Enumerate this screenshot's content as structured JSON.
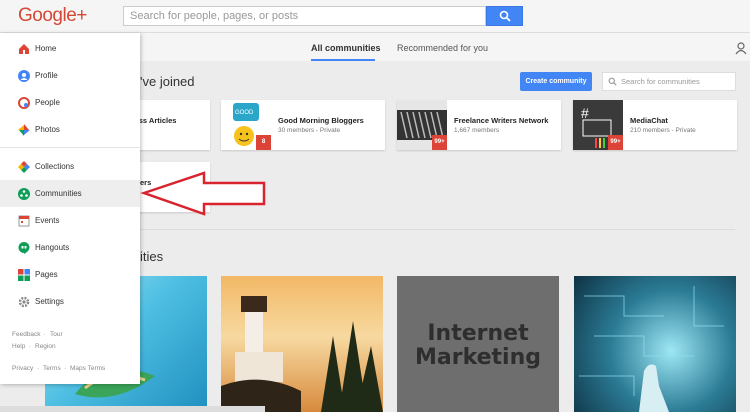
{
  "header": {
    "logo": "Google+",
    "search_placeholder": "Search for people, pages, or posts"
  },
  "tabs": [
    {
      "label": "All communities"
    },
    {
      "label": "Recommended for you"
    }
  ],
  "joined": {
    "heading": "'ve joined",
    "create_label": "Create community",
    "search_placeholder": "Search for communities",
    "cards": [
      {
        "name": "ness Articles",
        "meta": ""
      },
      {
        "name": "Good Morning Bloggers",
        "meta": "30 members - Private",
        "badge": "8"
      },
      {
        "name": "Freelance Writers Network",
        "meta": "1,667 members",
        "badge": "99+"
      },
      {
        "name": "MediaChat",
        "meta": "210 members - Private",
        "badge": "99+"
      },
      {
        "name": "ers",
        "meta": ""
      }
    ]
  },
  "recommended": {
    "heading": "ities",
    "internet_marketing": "Internet Marketing"
  },
  "sidebar": {
    "items": [
      {
        "label": "Home",
        "icon": "home-icon"
      },
      {
        "label": "Profile",
        "icon": "profile-icon"
      },
      {
        "label": "People",
        "icon": "people-icon"
      },
      {
        "label": "Photos",
        "icon": "photos-icon"
      },
      {
        "label": "Collections",
        "icon": "collections-icon"
      },
      {
        "label": "Communities",
        "icon": "communities-icon"
      },
      {
        "label": "Events",
        "icon": "events-icon"
      },
      {
        "label": "Hangouts",
        "icon": "hangouts-icon"
      },
      {
        "label": "Pages",
        "icon": "pages-icon"
      },
      {
        "label": "Settings",
        "icon": "settings-icon"
      }
    ],
    "footer": {
      "feedback": "Feedback",
      "dot1": "·",
      "tour": "Tour",
      "help": "Help",
      "dot2": "·",
      "region": "Region",
      "privacy": "Privacy",
      "dot3": "·",
      "terms": "Terms",
      "dot4": "·",
      "maps_terms": "Maps Terms"
    }
  },
  "colors": {
    "accent": "#4285f4",
    "brand": "#d34836",
    "annotation": "#d9232e"
  }
}
